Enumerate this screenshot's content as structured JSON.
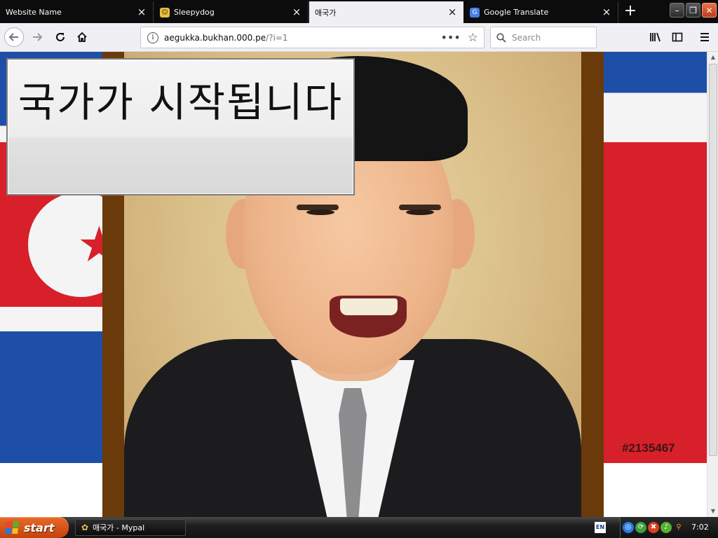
{
  "browser": {
    "tabs": [
      {
        "label": "Website Name",
        "favicon": "",
        "active": false
      },
      {
        "label": "Sleepydog",
        "favicon": "dog-face-icon",
        "active": false
      },
      {
        "label": "애국가",
        "favicon": "",
        "active": true
      },
      {
        "label": "Google Translate",
        "favicon": "google-translate-icon",
        "active": false
      }
    ],
    "close_glyph": "×",
    "new_tab_glyph": "+",
    "window_buttons": {
      "minimize": "–",
      "restore": "❐",
      "close": "✕"
    }
  },
  "navbar": {
    "url_host": "aegukka.bukhan.000.pe",
    "url_path": "/?i=1",
    "search_placeholder": "Search",
    "page_actions_glyph": "•••"
  },
  "page": {
    "dialog_text": "국가가 시작됩니다",
    "image_number": "#2135467"
  },
  "taskbar": {
    "start_label": "start",
    "window_item": "애국가 - Mypal",
    "language": "EN",
    "clock": "7:02"
  },
  "colors": {
    "flag_blue": "#1e4fa8",
    "flag_red": "#d8202a",
    "start_orange": "#d85818",
    "frame_brown": "#6a3a0a"
  }
}
